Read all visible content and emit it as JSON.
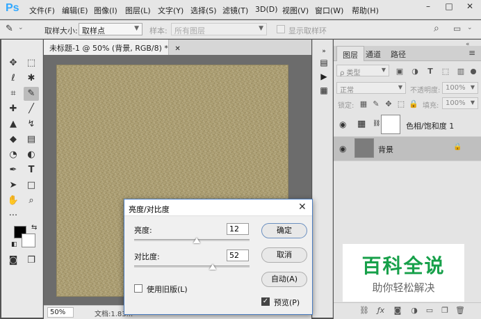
{
  "app": {
    "logo": "Ps"
  },
  "menu": [
    "文件(F)",
    "编辑(E)",
    "图像(I)",
    "图层(L)",
    "文字(Y)",
    "选择(S)",
    "滤镜(T)",
    "3D(D)",
    "视图(V)",
    "窗口(W)",
    "帮助(H)"
  ],
  "window_controls": {
    "minimize": "–",
    "maximize": "□",
    "close": "✕"
  },
  "options": {
    "sample_size_label": "取样大小:",
    "sample_size_value": "取样点",
    "sample_label": "样本:",
    "sample_value": "所有图层",
    "show_ring_label": "显示取样环"
  },
  "document": {
    "tab_title": "未标题-1 @ 50% (背景, RGB/8) *",
    "zoom": "50%",
    "info": "文档:1.83...",
    "canvas_color": "#ad9f73"
  },
  "panel": {
    "tabs": [
      "图层",
      "通道",
      "路径"
    ],
    "filter_kind": "ρ 类型",
    "blend_mode": "正常",
    "opacity_label": "不透明度:",
    "opacity_value": "100%",
    "lock_label": "锁定:",
    "fill_label": "填充:",
    "fill_value": "100%",
    "layers": [
      {
        "name": "色相/饱和度 1"
      },
      {
        "name": "背景"
      }
    ]
  },
  "watermark": {
    "title": "百科全说",
    "subtitle": "助你轻松解决",
    "color": "#17a04a"
  },
  "dialog": {
    "title": "亮度/对比度",
    "brightness_label": "亮度:",
    "brightness_value": "12",
    "brightness_min": -150,
    "brightness_max": 150,
    "contrast_label": "对比度:",
    "contrast_value": "52",
    "contrast_min": -50,
    "contrast_max": 100,
    "ok_label": "确定",
    "cancel_label": "取消",
    "auto_label": "自动(A)",
    "legacy_label": "使用旧版(L)",
    "legacy_checked": false,
    "preview_label": "预览(P)",
    "preview_checked": true
  }
}
